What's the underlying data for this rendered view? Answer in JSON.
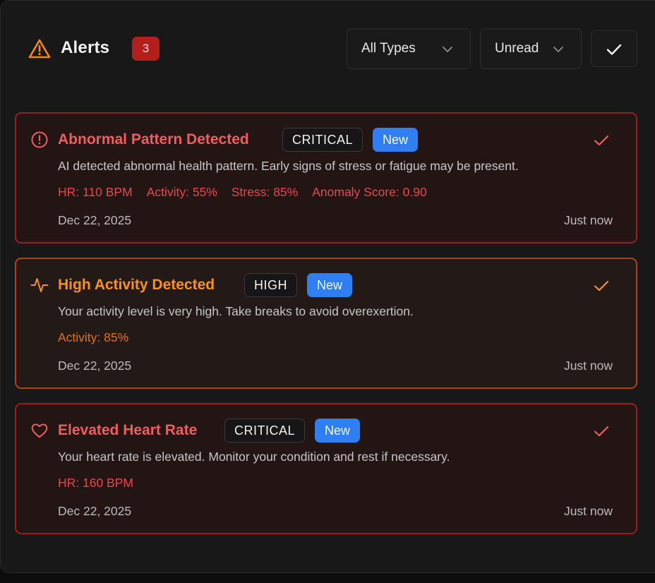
{
  "header": {
    "title": "Alerts",
    "count": "3",
    "type_filter": "All Types",
    "read_filter": "Unread",
    "mark_all_icon": "check-icon"
  },
  "colors": {
    "critical_title": "#f05d60",
    "high_title": "#f7931a",
    "critical_border": "#9c1d1f",
    "high_border": "#b2410f",
    "new_badge": "#2f7ff3",
    "count_badge": "#b31f1b"
  },
  "alerts": [
    {
      "icon": "alert-circle-icon",
      "title": "Abnormal Pattern Detected",
      "severity": "CRITICAL",
      "status": "New",
      "message": "AI detected abnormal health pattern. Early signs of stress or fatigue may be present.",
      "metrics": [
        "HR: 110 BPM",
        "Activity: 55%",
        "Stress: 85%",
        "Anomaly Score: 0.90"
      ],
      "date": "Dec 22, 2025",
      "time_ago": "Just now"
    },
    {
      "icon": "activity-pulse-icon",
      "title": "High Activity Detected",
      "severity": "HIGH",
      "status": "New",
      "message": "Your activity level is very high. Take breaks to avoid overexertion.",
      "metrics": [
        "Activity: 85%"
      ],
      "date": "Dec 22, 2025",
      "time_ago": "Just now"
    },
    {
      "icon": "heart-icon",
      "title": "Elevated Heart Rate",
      "severity": "CRITICAL",
      "status": "New",
      "message": "Your heart rate is elevated. Monitor your condition and rest if necessary.",
      "metrics": [
        "HR: 160 BPM"
      ],
      "date": "Dec 22, 2025",
      "time_ago": "Just now"
    }
  ]
}
